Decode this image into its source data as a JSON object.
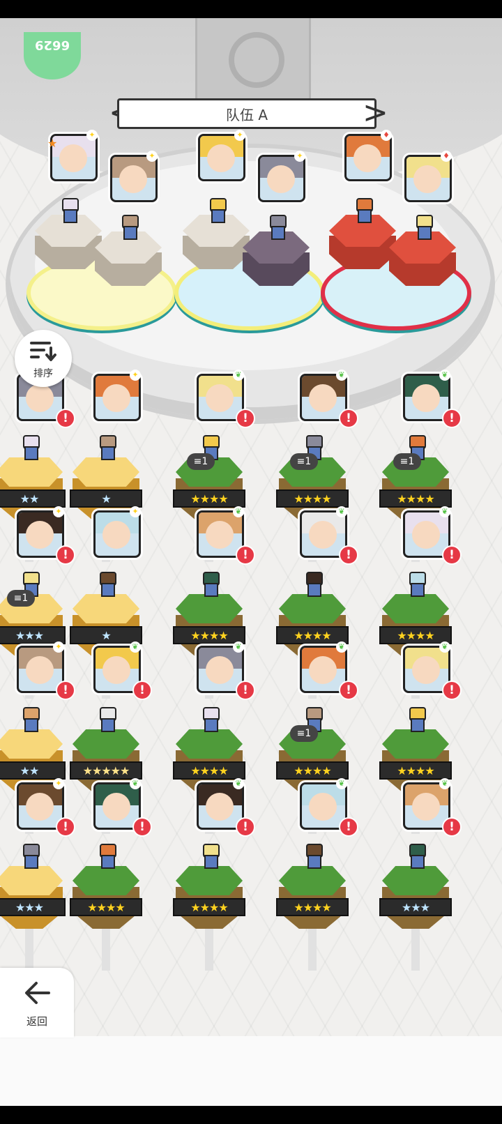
{
  "money": {
    "value": "6629"
  },
  "team": {
    "name": "队伍 A",
    "prev_label": "<",
    "next_label": ">"
  },
  "buttons": {
    "sort_label": "排序",
    "back_label": "返回"
  },
  "colors": {
    "light": "#ffd21f",
    "nature": "#56c247",
    "fire": "#e8483f",
    "dark": "#4a3b6b",
    "alert": "#e63946"
  },
  "team_slots": [
    {
      "element": "light",
      "rank": "★",
      "members": [
        "white-haired-demon",
        "brown-haired-girl"
      ]
    },
    {
      "element": "light",
      "rank": "",
      "members": [
        "blonde-knight",
        "grey-bearded-warrior"
      ]
    },
    {
      "element": "fire",
      "rank": "",
      "members": [
        "orange-haired-girl",
        "blonde-princess"
      ]
    }
  ],
  "roster": [
    {
      "row": 1,
      "col": 0,
      "element": "light",
      "tile": "gold",
      "stars": "★★",
      "dup": "",
      "alert": "!"
    },
    {
      "row": 1,
      "col": 1,
      "element": "light",
      "tile": "gold",
      "stars": "★",
      "dup": "",
      "alert": ""
    },
    {
      "row": 1,
      "col": 2,
      "element": "nature",
      "tile": "green",
      "stars": "★★★★",
      "dup": "1",
      "alert": "!"
    },
    {
      "row": 1,
      "col": 3,
      "element": "nature",
      "tile": "green",
      "stars": "★★★★",
      "dup": "1",
      "alert": "!"
    },
    {
      "row": 1,
      "col": 4,
      "element": "nature",
      "tile": "green",
      "stars": "★★★★",
      "dup": "1",
      "alert": "!"
    },
    {
      "row": 2,
      "col": 0,
      "element": "light",
      "tile": "gold",
      "stars": "★★★",
      "dup": "1",
      "alert": "!"
    },
    {
      "row": 2,
      "col": 1,
      "element": "light",
      "tile": "gold",
      "stars": "★",
      "dup": "",
      "alert": ""
    },
    {
      "row": 2,
      "col": 2,
      "element": "nature",
      "tile": "green",
      "stars": "★★★★",
      "dup": "",
      "alert": "!"
    },
    {
      "row": 2,
      "col": 3,
      "element": "nature",
      "tile": "green",
      "stars": "★★★★",
      "dup": "",
      "alert": "!"
    },
    {
      "row": 2,
      "col": 4,
      "element": "nature",
      "tile": "green",
      "stars": "★★★★",
      "dup": "",
      "alert": "!"
    },
    {
      "row": 3,
      "col": 0,
      "element": "light",
      "tile": "gold",
      "stars": "★★",
      "dup": "",
      "alert": "!"
    },
    {
      "row": 3,
      "col": 1,
      "element": "nature",
      "tile": "green",
      "stars": "★★★★★",
      "dup": "",
      "alert": "!"
    },
    {
      "row": 3,
      "col": 2,
      "element": "nature",
      "tile": "green",
      "stars": "★★★★",
      "dup": "",
      "alert": "!"
    },
    {
      "row": 3,
      "col": 3,
      "element": "nature",
      "tile": "green",
      "stars": "★★★★",
      "dup": "1",
      "alert": "!"
    },
    {
      "row": 3,
      "col": 4,
      "element": "nature",
      "tile": "green",
      "stars": "★★★★",
      "dup": "",
      "alert": "!"
    },
    {
      "row": 4,
      "col": 0,
      "element": "light",
      "tile": "gold",
      "stars": "★★★",
      "dup": "",
      "alert": "!"
    },
    {
      "row": 4,
      "col": 1,
      "element": "nature",
      "tile": "green",
      "stars": "★★★★",
      "dup": "",
      "alert": "!"
    },
    {
      "row": 4,
      "col": 2,
      "element": "nature",
      "tile": "green",
      "stars": "★★★★",
      "dup": "",
      "alert": "!"
    },
    {
      "row": 4,
      "col": 3,
      "element": "nature",
      "tile": "green",
      "stars": "★★★★",
      "dup": "",
      "alert": "!"
    },
    {
      "row": 4,
      "col": 4,
      "element": "nature",
      "tile": "green",
      "stars": "★★★",
      "dup": "",
      "alert": "!"
    }
  ]
}
